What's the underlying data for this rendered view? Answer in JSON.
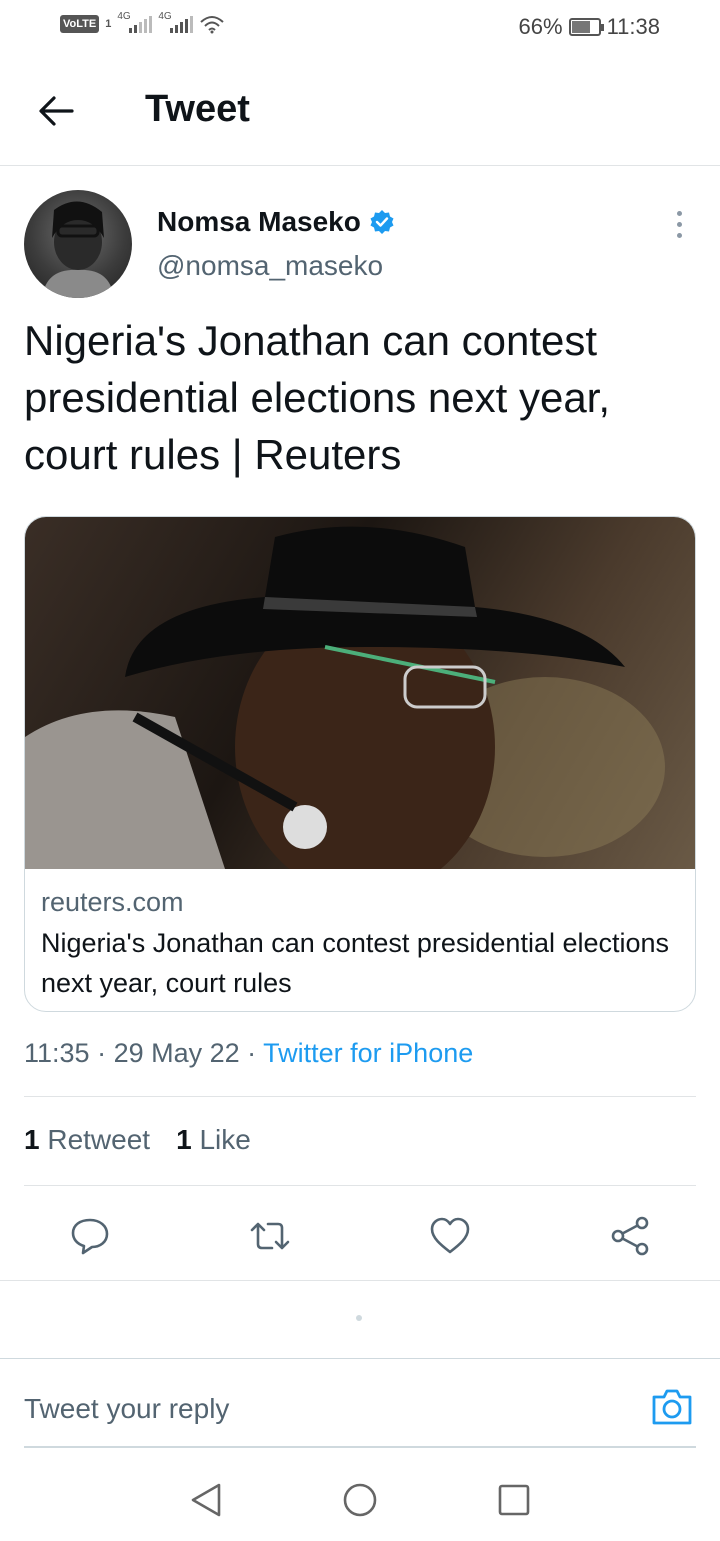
{
  "status_bar": {
    "volte": "VoLTE",
    "sim": "1",
    "network1": "4G",
    "network2": "4G",
    "battery": "66%",
    "battery_level": 0.66,
    "time": "11:38"
  },
  "header": {
    "title": "Tweet"
  },
  "tweet": {
    "author_name": "Nomsa Maseko",
    "verified": true,
    "handle": "@nomsa_maseko",
    "text": "Nigeria's Jonathan can contest presidential elections next year, court rules | Reuters",
    "card": {
      "domain": "reuters.com",
      "title": "Nigeria's Jonathan can contest presidential elections next year, court rules"
    },
    "time": "11:35",
    "date": "29 May 22",
    "source": "Twitter for iPhone",
    "separator": " · ",
    "retweet_count": "1",
    "retweet_label": "Retweet",
    "like_count": "1",
    "like_label": "Like"
  },
  "actions": [
    "reply",
    "retweet",
    "like",
    "share"
  ],
  "reply": {
    "placeholder": "Tweet your reply"
  },
  "colors": {
    "accent": "#1d9bf0",
    "text": "#0f1419",
    "muted": "#536471"
  }
}
